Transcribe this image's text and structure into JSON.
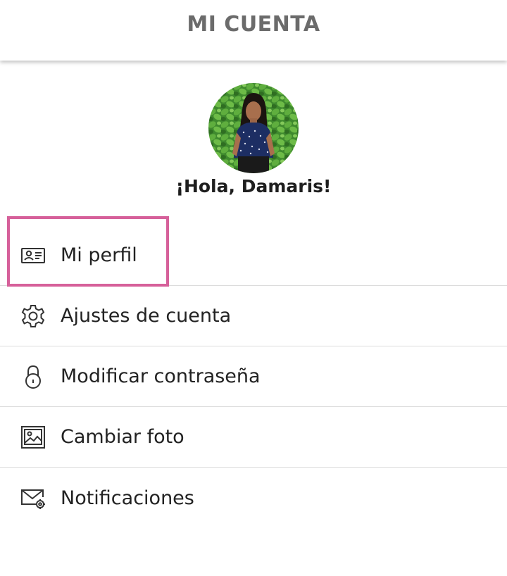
{
  "header": {
    "title": "MI CUENTA"
  },
  "profile": {
    "greeting": "¡Hola, Damaris!"
  },
  "menu": {
    "items": [
      {
        "label": "Mi perfil",
        "icon": "id-card-icon"
      },
      {
        "label": "Ajustes de cuenta",
        "icon": "gear-icon"
      },
      {
        "label": "Modificar contraseña",
        "icon": "lock-icon"
      },
      {
        "label": "Cambiar foto",
        "icon": "image-icon"
      },
      {
        "label": "Notificaciones",
        "icon": "mail-settings-icon"
      }
    ]
  },
  "colors": {
    "highlight": "#d6609a",
    "header_text": "#6b6b6b",
    "divider": "#dcdcdc"
  }
}
